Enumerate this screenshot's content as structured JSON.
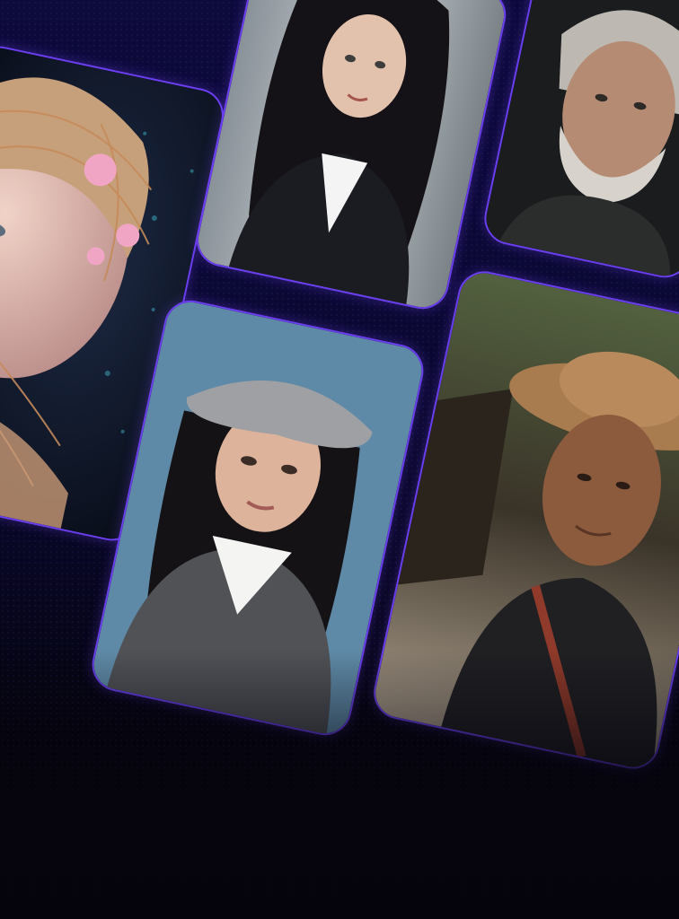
{
  "gallery": {
    "cards": [
      {
        "subject": "fantasy-woman-floral-headpiece-portrait",
        "accent": "#e9a6c8"
      },
      {
        "subject": "businesswoman-black-blazer-portrait",
        "accent": "#1a1a1f"
      },
      {
        "subject": "elderly-man-gray-beard-portrait",
        "accent": "#cfcac2"
      },
      {
        "subject": "young-woman-gray-beret-portrait",
        "accent": "#8a8d93"
      },
      {
        "subject": "man-straw-hat-portrait",
        "accent": "#a4764a"
      }
    ]
  },
  "colors": {
    "card_border": "#6b3ff0",
    "background_top": "#0d0a3c",
    "background_bottom": "#05040d"
  }
}
